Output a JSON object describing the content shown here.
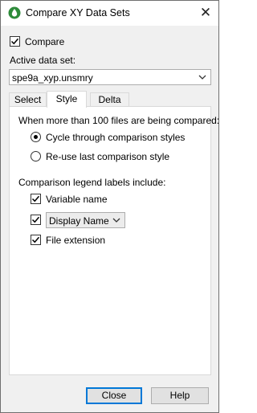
{
  "window": {
    "title": "Compare XY Data Sets",
    "close_glyph": "✕",
    "app_icon": "droplet-icon"
  },
  "compare": {
    "label": "Compare",
    "checked": true
  },
  "active_data_set": {
    "label": "Active data set:",
    "value": "spe9a_xyp.unsmry"
  },
  "tabs": [
    {
      "label": "Select",
      "active": false
    },
    {
      "label": "Style",
      "active": true
    },
    {
      "label": "Delta",
      "active": false
    }
  ],
  "style_tab": {
    "many_files_heading": "When more than 100 files are being compared:",
    "radio_options": [
      {
        "label": "Cycle through comparison styles",
        "selected": true
      },
      {
        "label": "Re-use last comparison style",
        "selected": false
      }
    ],
    "legend_heading": "Comparison legend labels include:",
    "variable_name": {
      "label": "Variable name",
      "checked": true
    },
    "display_name": {
      "checked": true,
      "value": "Display Name"
    },
    "file_extension": {
      "label": "File extension",
      "checked": true
    }
  },
  "buttons": {
    "close": "Close",
    "help": "Help"
  }
}
